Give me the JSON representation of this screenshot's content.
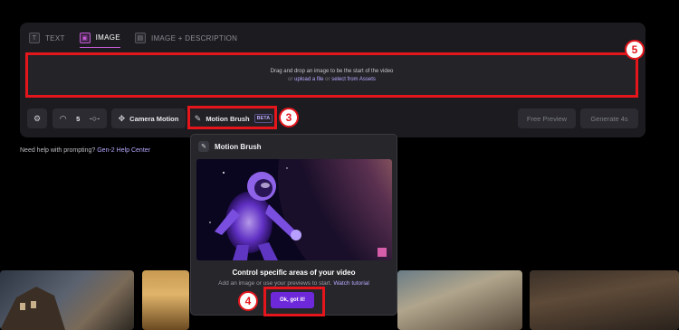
{
  "tabs": [
    {
      "label": "TEXT",
      "icon": "text-icon",
      "active": false
    },
    {
      "label": "IMAGE",
      "icon": "image-icon",
      "active": true
    },
    {
      "label": "IMAGE + DESCRIPTION",
      "icon": "image-description-icon",
      "active": false
    }
  ],
  "dropzone": {
    "line1": "Drag and drop an image to be the start of the video",
    "or1": "or",
    "upload_link": "upload a file",
    "or2": "or",
    "assets_link": "select from Assets"
  },
  "toolbar": {
    "settings_icon": "sliders-icon",
    "motion_icon": "speedometer-icon",
    "motion_value": "5",
    "stepper_icon": "arrows-icon",
    "camera_motion_label": "Camera Motion",
    "motion_brush_label": "Motion Brush",
    "beta_label": "BETA",
    "free_preview_label": "Free Preview",
    "generate_label": "Generate 4s"
  },
  "help": {
    "prefix": "Need help with prompting?",
    "link": "Gen-2 Help Center"
  },
  "popover": {
    "title": "Motion Brush",
    "heading": "Control specific areas of your video",
    "sub_prefix": "Add an image or use your previews to start.",
    "sub_link": "Watch tutorial",
    "ok_label": "Ok, got it!"
  },
  "annotations": {
    "badge_5": "5",
    "badge_3": "3",
    "badge_4": "4"
  },
  "colors": {
    "accent": "#6d28d9",
    "highlight": "#e4161c",
    "link": "#b9a9ff"
  }
}
